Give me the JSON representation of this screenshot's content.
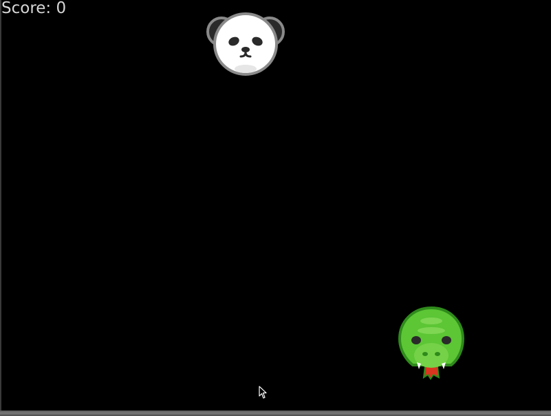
{
  "score": {
    "label": "Score: 0",
    "value": 0
  },
  "sprites": {
    "enemy": "panda-face-icon",
    "player": "crocodile-face-icon"
  },
  "colors": {
    "background": "#000000",
    "score_text": "#d6d6d6",
    "panda_face": "#ffffff",
    "panda_features": "#2a2a2a",
    "croc_body": "#5cc635",
    "croc_outline": "#2f8a1c",
    "croc_tongue": "#d9361f"
  }
}
